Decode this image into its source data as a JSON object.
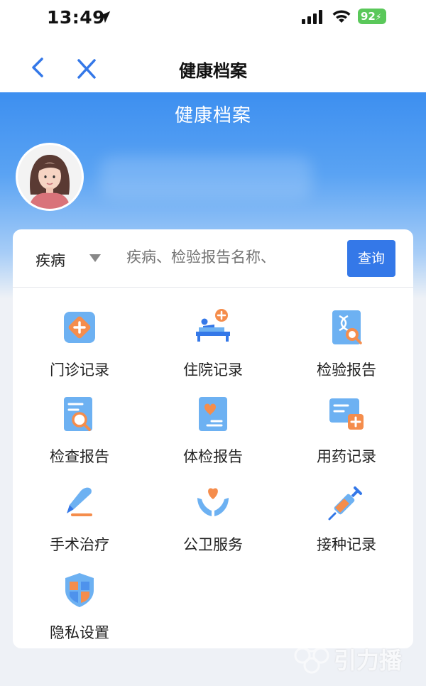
{
  "status_bar": {
    "time": "13:49",
    "battery": "92"
  },
  "nav": {
    "title": "健康档案"
  },
  "hero": {
    "title": "健康档案"
  },
  "search": {
    "category": "疾病",
    "placeholder": "疾病、检验报告名称、",
    "button": "查询"
  },
  "menu": [
    {
      "label": "门诊记录",
      "icon": "clinic-record-icon"
    },
    {
      "label": "住院记录",
      "icon": "hospital-bed-icon"
    },
    {
      "label": "检验报告",
      "icon": "lab-dna-icon"
    },
    {
      "label": "检查报告",
      "icon": "exam-report-icon"
    },
    {
      "label": "体检报告",
      "icon": "physical-exam-icon"
    },
    {
      "label": "用药记录",
      "icon": "medication-card-icon"
    },
    {
      "label": "手术治疗",
      "icon": "scalpel-icon"
    },
    {
      "label": "公卫服务",
      "icon": "heart-hands-icon"
    },
    {
      "label": "接种记录",
      "icon": "syringe-icon"
    },
    {
      "label": "隐私设置",
      "icon": "shield-icon"
    }
  ],
  "watermark": "引力播",
  "colors": {
    "primary": "#3478e8",
    "orange": "#f58d4c",
    "light_blue": "#6db1f2"
  }
}
